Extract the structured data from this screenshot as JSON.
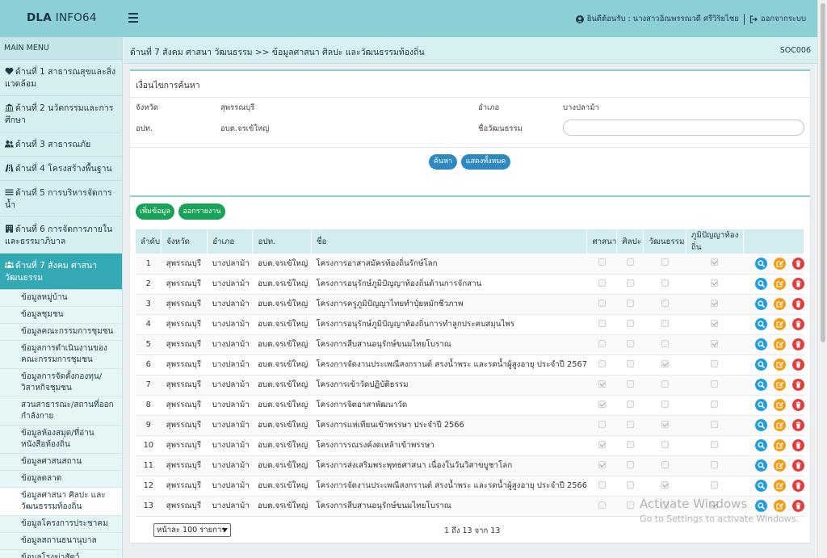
{
  "header": {
    "brand_bold": "DLA",
    "brand_light": "INFO64",
    "welcome": "ยินดีต้อนรับ : นางสาวอิณพรรณวดี ศรีวิริยไชย",
    "logout": "ออกจากระบบ"
  },
  "sidebar": {
    "title": "MAIN MENU",
    "sections": [
      {
        "icon": "heartbeat-icon",
        "label": "ด้านที่ 1 สาธารณสุขและสิ่งแวดล้อม"
      },
      {
        "icon": "bank-icon",
        "label": "ด้านที่ 2 นวัตกรรมและการศึกษา"
      },
      {
        "icon": "users-icon",
        "label": "ด้านที่ 3 สาธารณภัย"
      },
      {
        "icon": "road-icon",
        "label": "ด้านที่ 4 โครงสร้างพื้นฐาน"
      },
      {
        "icon": "list-icon",
        "label": "ด้านที่ 5 การบริหารจัดการน้ำ"
      },
      {
        "icon": "building-icon",
        "label": "ด้านที่ 6 การจัดการภายในและธรรมาภิบาล"
      },
      {
        "icon": "people-icon",
        "label": "ด้านที่ 7 สังคม ศาสนา วัฒนธรรม"
      }
    ],
    "subitems": [
      "ข้อมูลหมู่บ้าน",
      "ข้อมูลชุมชน",
      "ข้อมูลคณะกรรมการชุมชน",
      "ข้อมูลการดำเนินงานของคณะกรรมการชุมชน",
      "ข้อมูลการจัดตั้งกองทุน/วิสาหกิจชุมชน",
      "สวนสาธารณะ/สถานที่ออกกำลังกาย",
      "ข้อมูลห้องสมุด/ที่อ่านหนังสือท้องถิ่น",
      "ข้อมูลศาสนสถาน",
      "ข้อมูลตลาด",
      "ข้อมูลศาสนา ศิลปะ และวัฒนธรรมท้องถิ่น",
      "ข้อมูลโครงการประชาคม",
      "ข้อมูลสถานธนานุบาล",
      "ข้อมูลโรงฆ่าสัตว์",
      "ข้อมูลกล้องCCTV"
    ]
  },
  "breadcrumb": {
    "text": "ด้านที่ 7 สังคม ศาสนา วัฒนธรรม >>  ข้อมูลศาสนา ศิลปะ และวัฒนธรรมท้องถิ่น",
    "code": "SOC006"
  },
  "search": {
    "title": "เงื่อนไขการค้นหา",
    "province_label": "จังหวัด",
    "province_value": "สุพรรณบุรี",
    "district_label": "อำเภอ",
    "district_value": "บางปลาม้า",
    "org_label": "อปท.",
    "org_value": "อบต.จรเข้ใหญ่",
    "culture_label": "ชื่อวัฒนธรรม",
    "culture_value": "",
    "search_btn": "ค้นหา",
    "showall_btn": "แสดงทั้งหมด"
  },
  "toolbar": {
    "add_btn": "เพิ่มข้อมูล",
    "report_btn": "ออกรายงาน"
  },
  "table": {
    "headers": [
      "ลำดับ",
      "จังหวัด",
      "อำเภอ",
      "อปท.",
      "ชื่อ",
      "ศาสนา",
      "ศิลปะ",
      "วัฒนธรรม",
      "ภูมิปัญญาท้องถิ่น"
    ],
    "rows": [
      {
        "no": "1",
        "province": "สุพรรณบุรี",
        "district": "บางปลาม้า",
        "org": "อบต.จรเข้ใหญ่",
        "name": "โครงการอาสาสมัครท้องถิ่นรักษ์โลก",
        "checks": [
          false,
          false,
          false,
          true
        ]
      },
      {
        "no": "2",
        "province": "สุพรรณบุรี",
        "district": "บางปลาม้า",
        "org": "อบต.จรเข้ใหญ่",
        "name": "โครงการอนุรักษ์ภูมิปัญญาท้องถิ่นด้านการจักสาน",
        "checks": [
          false,
          false,
          false,
          true
        ]
      },
      {
        "no": "3",
        "province": "สุพรรณบุรี",
        "district": "บางปลาม้า",
        "org": "อบต.จรเข้ใหญ่",
        "name": "โครงการครูภูมิปัญญาไทยทำปุ๋ยหมักชีวภาพ",
        "checks": [
          false,
          false,
          false,
          true
        ]
      },
      {
        "no": "4",
        "province": "สุพรรณบุรี",
        "district": "บางปลาม้า",
        "org": "อบต.จรเข้ใหญ่",
        "name": "โครงการอนุรักษ์ภูมิปัญญาท้องถิ่นการทำลูกประคบสมุนไพร",
        "checks": [
          false,
          false,
          false,
          true
        ]
      },
      {
        "no": "5",
        "province": "สุพรรณบุรี",
        "district": "บางปลาม้า",
        "org": "อบต.จรเข้ใหญ่",
        "name": "โครงการสืบสานอนุรักษ์ขนมไทยโบราณ",
        "checks": [
          false,
          false,
          false,
          true
        ]
      },
      {
        "no": "6",
        "province": "สุพรรณบุรี",
        "district": "บางปลาม้า",
        "org": "อบต.จรเข้ใหญ่",
        "name": "โครงการจัดงานประเพณีสงกรานต์ สรงน้ำพระ และรดน้ำผู้สูงอายุ ประจำปี 2567",
        "checks": [
          false,
          false,
          true,
          false
        ]
      },
      {
        "no": "7",
        "province": "สุพรรณบุรี",
        "district": "บางปลาม้า",
        "org": "อบต.จรเข้ใหญ่",
        "name": "โครงการเข้าวัดปฏิบัติธรรม",
        "checks": [
          true,
          false,
          false,
          false
        ]
      },
      {
        "no": "8",
        "province": "สุพรรณบุรี",
        "district": "บางปลาม้า",
        "org": "อบต.จรเข้ใหญ่",
        "name": "โครงการจิตอาสาพัฒนาวัด",
        "checks": [
          true,
          false,
          false,
          false
        ]
      },
      {
        "no": "9",
        "province": "สุพรรณบุรี",
        "district": "บางปลาม้า",
        "org": "อบต.จรเข้ใหญ่",
        "name": "โครงการแห่เทียนเข้าพรรษา ประจำปี 2566",
        "checks": [
          false,
          false,
          true,
          false
        ]
      },
      {
        "no": "10",
        "province": "สุพรรณบุรี",
        "district": "บางปลาม้า",
        "org": "อบต.จรเข้ใหญ่",
        "name": "โครงการรณรงค์งดเหล้าเข้าพรรษา",
        "checks": [
          true,
          false,
          false,
          false
        ]
      },
      {
        "no": "11",
        "province": "สุพรรณบุรี",
        "district": "บางปลาม้า",
        "org": "อบต.จรเข้ใหญ่",
        "name": "โครงการส่งเสริมพระพุทธศาสนา เนื่องในวันวิสาขบูชาโลก",
        "checks": [
          true,
          false,
          false,
          false
        ]
      },
      {
        "no": "12",
        "province": "สุพรรณบุรี",
        "district": "บางปลาม้า",
        "org": "อบต.จรเข้ใหญ่",
        "name": "โครงการจัดงานประเพณีสงกรานต์ สรงน้ำพระ และรดน้ำผู้สูงอายุ ประจำปี 2566",
        "checks": [
          false,
          false,
          true,
          false
        ]
      },
      {
        "no": "13",
        "province": "สุพรรณบุรี",
        "district": "บางปลาม้า",
        "org": "อบต.จรเข้ใหญ่",
        "name": "โครงการสืบสานอนุรักษ์ขนมไทยโบราณ",
        "checks": [
          false,
          false,
          false,
          true
        ]
      }
    ]
  },
  "pagination": {
    "page_size": "หน้าละ 100 รายการ",
    "info": "1 ถึง 13 จาก 13"
  },
  "watermark": {
    "line1": "Activate Windows",
    "line2": "Go to Settings to activate Windows."
  }
}
